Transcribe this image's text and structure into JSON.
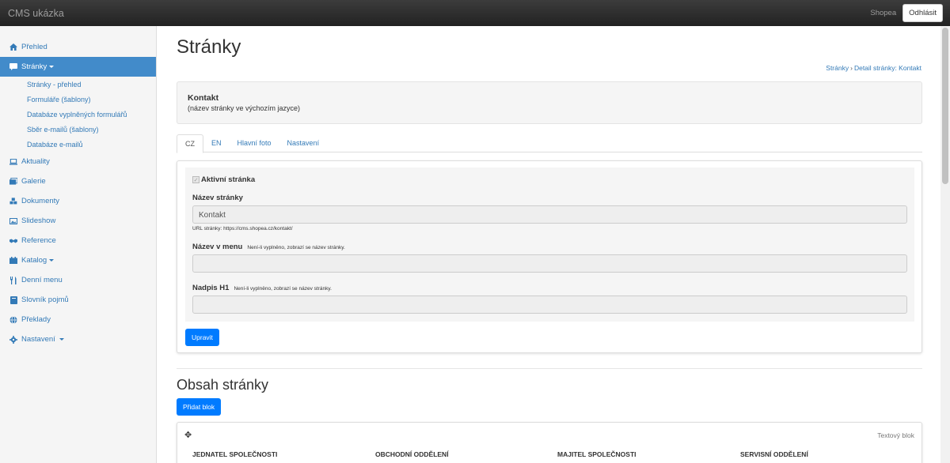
{
  "navbar": {
    "brand": "CMS ukázka",
    "user": "Shopea",
    "logout_label": "Odhlásit"
  },
  "sidebar": {
    "items": [
      {
        "label": "Přehled",
        "icon": "home-icon"
      },
      {
        "label": "Stránky",
        "icon": "comment-icon",
        "active": true
      },
      {
        "label": "Aktuality",
        "icon": "laptop-icon"
      },
      {
        "label": "Galerie",
        "icon": "images-icon"
      },
      {
        "label": "Dokumenty",
        "icon": "cubes-icon"
      },
      {
        "label": "Slideshow",
        "icon": "picture-icon"
      },
      {
        "label": "Reference",
        "icon": "handshake-icon"
      },
      {
        "label": "Katalog",
        "icon": "catalog-icon"
      },
      {
        "label": "Denní menu",
        "icon": "cutlery-icon"
      },
      {
        "label": "Slovník pojmů",
        "icon": "book-icon"
      },
      {
        "label": "Překlady",
        "icon": "globe-icon"
      },
      {
        "label": "Nastavení",
        "icon": "gear-icon"
      }
    ],
    "subitems": [
      "Stránky - přehled",
      "Formuláře (šablony)",
      "Databáze vyplněných formulářů",
      "Sběr e-mailů (šablony)",
      "Databáze e-mailů"
    ]
  },
  "page": {
    "title": "Stránky",
    "breadcrumb": [
      "Stránky",
      "Detail stránky: Kontakt"
    ]
  },
  "info": {
    "title": "Kontakt",
    "subtitle": "(název stránky ve výchozím jazyce)"
  },
  "tabs": [
    "CZ",
    "EN",
    "Hlavní foto",
    "Nastavení"
  ],
  "form": {
    "active_label": "Aktivní stránka",
    "name_label": "Název stránky",
    "name_value": "Kontakt",
    "url_note": "URL stránky: https://cms.shopea.cz/kontakt/",
    "menu_label": "Název v menu",
    "menu_hint": "Není-li vyplněno, zobrazí se název stránky.",
    "menu_value": "",
    "h1_label": "Nadpis H1",
    "h1_hint": "Není-li vyplněno, zobrazí se název stránky.",
    "h1_value": "",
    "save_label": "Upravit"
  },
  "content": {
    "title": "Obsah stránky",
    "add_label": "Přidat blok",
    "block_type": "Textový blok",
    "columns": [
      "JEDNATEL SPOLEČNOSTI",
      "OBCHODNÍ ODDĚLENÍ",
      "MAJITEL SPOLEČNOSTI",
      "SERVISNÍ ODDĚLENÍ"
    ]
  },
  "colors": {
    "accent": "#337ab7",
    "active_nav": "#428bca",
    "primary_button": "#007bff",
    "navbar": "#222222"
  }
}
